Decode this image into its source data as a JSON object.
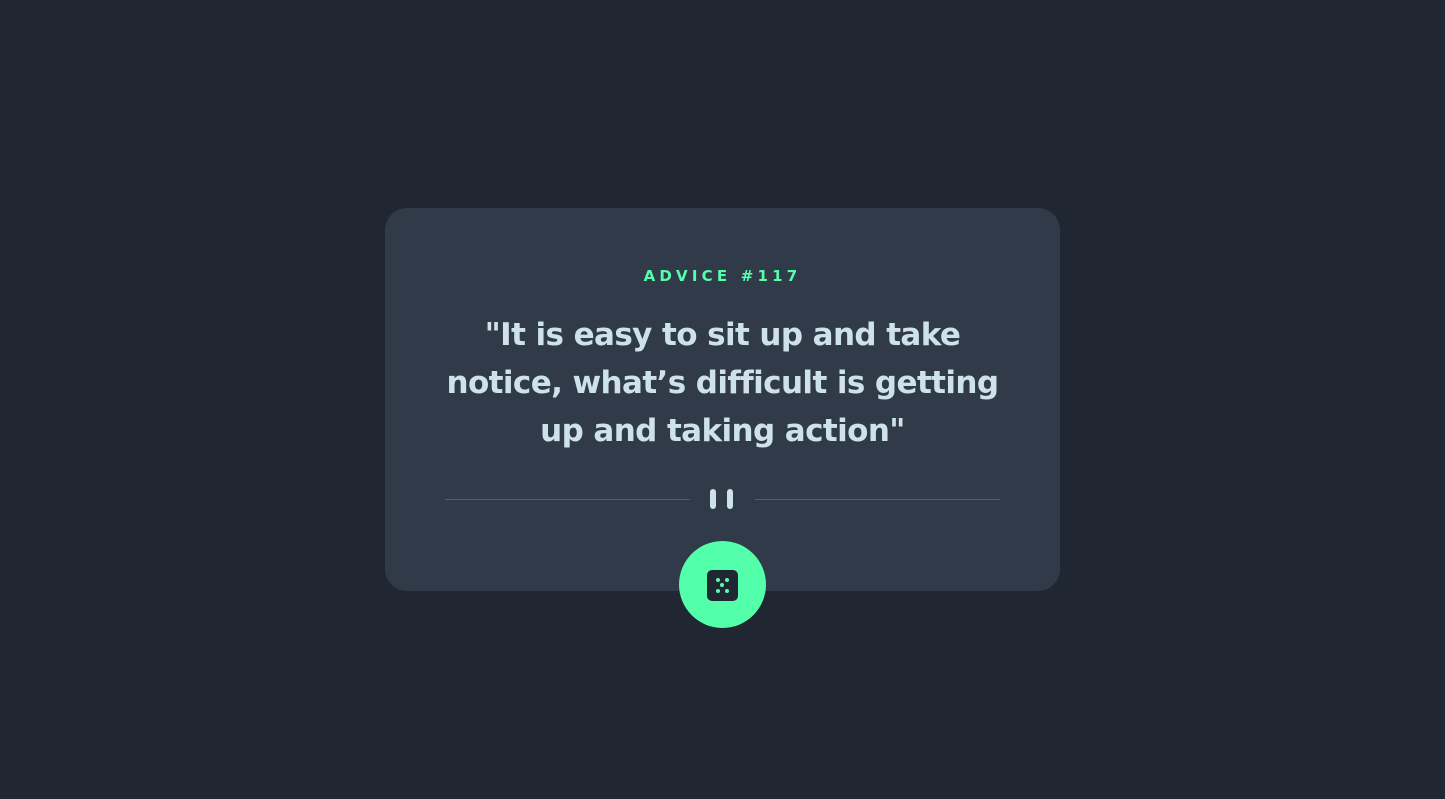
{
  "card": {
    "advice_label": "ADVICE #117",
    "quote": "\"It is easy to sit up and take notice, what’s difficult is getting up and taking action\""
  },
  "divider": {
    "icon": "pause-icon"
  },
  "action": {
    "icon": "dice-icon"
  },
  "colors": {
    "background": "#202733",
    "card": "#313a48",
    "accent": "#53ffaa",
    "text": "#cee3e9",
    "divider": "#4f5d74"
  }
}
